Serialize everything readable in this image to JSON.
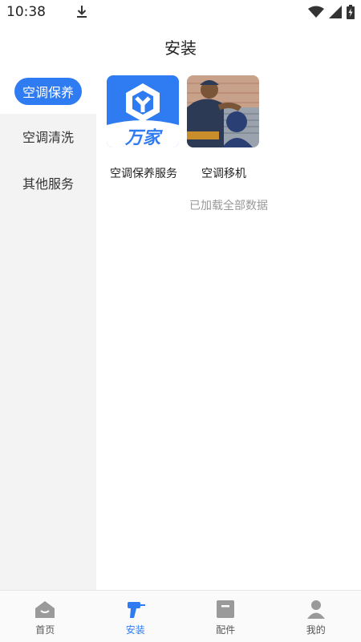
{
  "status_bar": {
    "time": "10:38"
  },
  "header": {
    "title": "安装"
  },
  "sidebar": {
    "items": [
      {
        "label": "空调保养",
        "active": true
      },
      {
        "label": "空调清洗",
        "active": false
      },
      {
        "label": "其他服务",
        "active": false
      }
    ]
  },
  "content": {
    "cards": [
      {
        "label": "空调保养服务",
        "logo_text": "万家"
      },
      {
        "label": "空调移机"
      }
    ],
    "loaded_note": "已加载全部数据"
  },
  "bottom_nav": {
    "items": [
      {
        "label": "首页",
        "icon": "home-icon",
        "active": false
      },
      {
        "label": "安装",
        "icon": "drill-icon",
        "active": true
      },
      {
        "label": "配件",
        "icon": "box-icon",
        "active": false
      },
      {
        "label": "我的",
        "icon": "user-icon",
        "active": false
      }
    ]
  },
  "colors": {
    "accent": "#2f7bf2",
    "sidebar_bg": "#f3f3f3",
    "muted_text": "#999999"
  }
}
